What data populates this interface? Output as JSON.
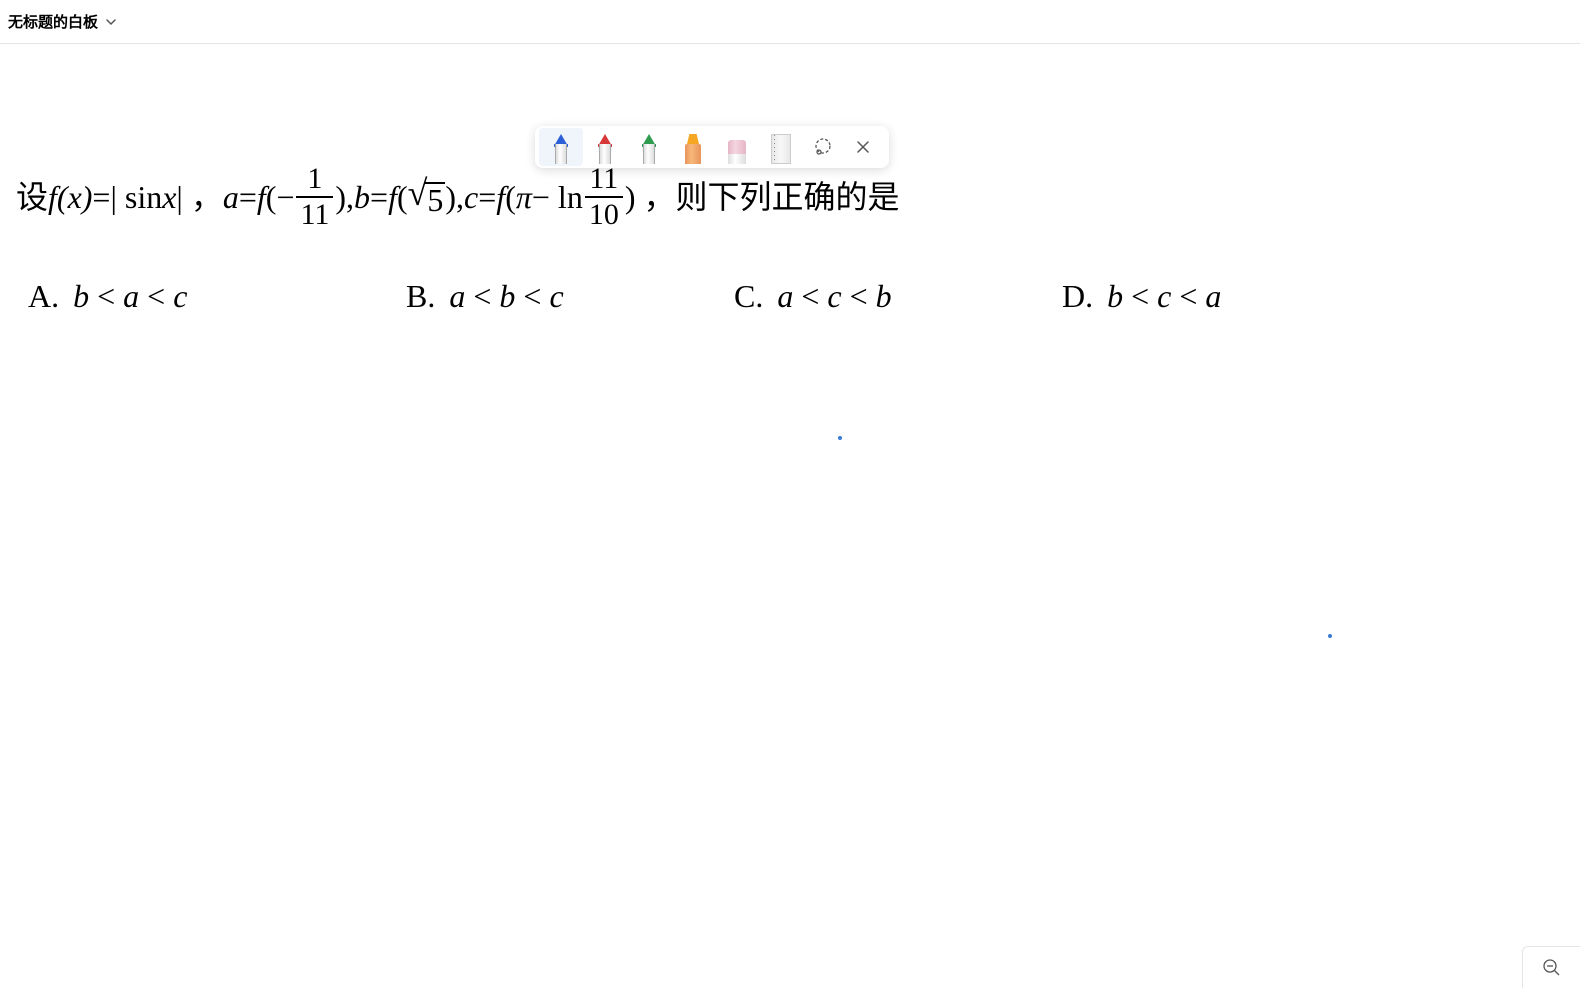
{
  "header": {
    "title": "无标题的白板"
  },
  "toolbar": {
    "tools": [
      {
        "name": "pen-blue",
        "selected": true
      },
      {
        "name": "pen-red",
        "selected": false
      },
      {
        "name": "pen-green",
        "selected": false
      },
      {
        "name": "highlighter-orange",
        "selected": false
      },
      {
        "name": "eraser",
        "selected": false
      },
      {
        "name": "ruler",
        "selected": false
      },
      {
        "name": "lasso",
        "selected": false
      },
      {
        "name": "close",
        "selected": false
      }
    ]
  },
  "math": {
    "prefix": "设 ",
    "fx": "f",
    "fx_arg": "(x)",
    "eq1": " =| sin ",
    "eq1b": "x",
    "eq1c": " | ，  ",
    "a_var": "a",
    "a_eq": " = ",
    "f2": "f",
    "a_open": "(−",
    "frac_a_num": "1",
    "frac_a_den": "11",
    "a_close": "), ",
    "b_var": "b",
    "b_eq": " = ",
    "f3": "f",
    "b_open": "(",
    "sqrt_content": "5",
    "b_close": "), ",
    "c_var": "c",
    "c_eq": " = ",
    "f4": "f",
    "c_open": "(",
    "pi": "π",
    "minus_ln": " − ln ",
    "frac_c_num": "11",
    "frac_c_den": "10",
    "c_close": ") ，",
    "suffix": "则下列正确的是",
    "options": {
      "A": {
        "label": "A.",
        "expr_parts": [
          "b",
          " < ",
          "a",
          " < ",
          "c"
        ]
      },
      "B": {
        "label": "B.",
        "expr_parts": [
          "a",
          " < ",
          "b",
          " < ",
          "c"
        ]
      },
      "C": {
        "label": "C.",
        "expr_parts": [
          "a",
          " < ",
          "c",
          " < ",
          "b"
        ]
      },
      "D": {
        "label": "D.",
        "expr_parts": [
          "b",
          " < ",
          "c",
          " < ",
          "a"
        ]
      }
    }
  }
}
